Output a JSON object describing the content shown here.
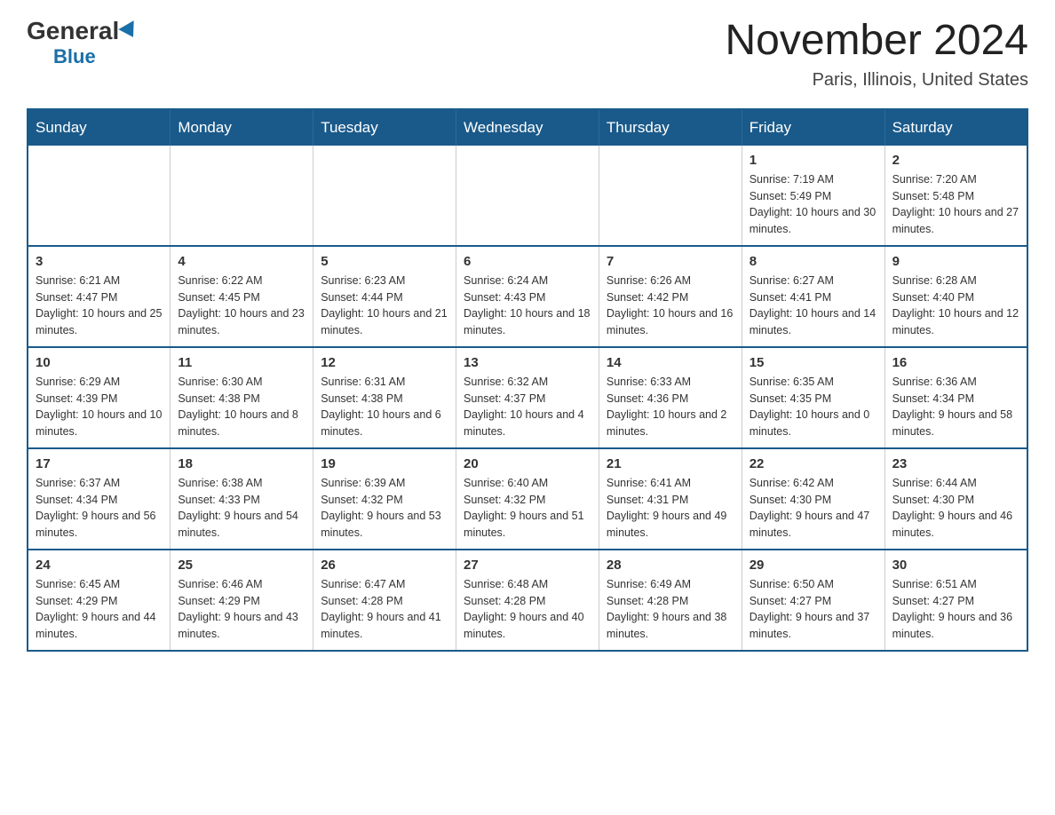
{
  "header": {
    "logo_general": "General",
    "logo_blue": "Blue",
    "month_title": "November 2024",
    "location": "Paris, Illinois, United States"
  },
  "days_of_week": [
    "Sunday",
    "Monday",
    "Tuesday",
    "Wednesday",
    "Thursday",
    "Friday",
    "Saturday"
  ],
  "weeks": [
    [
      {
        "day": "",
        "info": ""
      },
      {
        "day": "",
        "info": ""
      },
      {
        "day": "",
        "info": ""
      },
      {
        "day": "",
        "info": ""
      },
      {
        "day": "",
        "info": ""
      },
      {
        "day": "1",
        "info": "Sunrise: 7:19 AM\nSunset: 5:49 PM\nDaylight: 10 hours and 30 minutes."
      },
      {
        "day": "2",
        "info": "Sunrise: 7:20 AM\nSunset: 5:48 PM\nDaylight: 10 hours and 27 minutes."
      }
    ],
    [
      {
        "day": "3",
        "info": "Sunrise: 6:21 AM\nSunset: 4:47 PM\nDaylight: 10 hours and 25 minutes."
      },
      {
        "day": "4",
        "info": "Sunrise: 6:22 AM\nSunset: 4:45 PM\nDaylight: 10 hours and 23 minutes."
      },
      {
        "day": "5",
        "info": "Sunrise: 6:23 AM\nSunset: 4:44 PM\nDaylight: 10 hours and 21 minutes."
      },
      {
        "day": "6",
        "info": "Sunrise: 6:24 AM\nSunset: 4:43 PM\nDaylight: 10 hours and 18 minutes."
      },
      {
        "day": "7",
        "info": "Sunrise: 6:26 AM\nSunset: 4:42 PM\nDaylight: 10 hours and 16 minutes."
      },
      {
        "day": "8",
        "info": "Sunrise: 6:27 AM\nSunset: 4:41 PM\nDaylight: 10 hours and 14 minutes."
      },
      {
        "day": "9",
        "info": "Sunrise: 6:28 AM\nSunset: 4:40 PM\nDaylight: 10 hours and 12 minutes."
      }
    ],
    [
      {
        "day": "10",
        "info": "Sunrise: 6:29 AM\nSunset: 4:39 PM\nDaylight: 10 hours and 10 minutes."
      },
      {
        "day": "11",
        "info": "Sunrise: 6:30 AM\nSunset: 4:38 PM\nDaylight: 10 hours and 8 minutes."
      },
      {
        "day": "12",
        "info": "Sunrise: 6:31 AM\nSunset: 4:38 PM\nDaylight: 10 hours and 6 minutes."
      },
      {
        "day": "13",
        "info": "Sunrise: 6:32 AM\nSunset: 4:37 PM\nDaylight: 10 hours and 4 minutes."
      },
      {
        "day": "14",
        "info": "Sunrise: 6:33 AM\nSunset: 4:36 PM\nDaylight: 10 hours and 2 minutes."
      },
      {
        "day": "15",
        "info": "Sunrise: 6:35 AM\nSunset: 4:35 PM\nDaylight: 10 hours and 0 minutes."
      },
      {
        "day": "16",
        "info": "Sunrise: 6:36 AM\nSunset: 4:34 PM\nDaylight: 9 hours and 58 minutes."
      }
    ],
    [
      {
        "day": "17",
        "info": "Sunrise: 6:37 AM\nSunset: 4:34 PM\nDaylight: 9 hours and 56 minutes."
      },
      {
        "day": "18",
        "info": "Sunrise: 6:38 AM\nSunset: 4:33 PM\nDaylight: 9 hours and 54 minutes."
      },
      {
        "day": "19",
        "info": "Sunrise: 6:39 AM\nSunset: 4:32 PM\nDaylight: 9 hours and 53 minutes."
      },
      {
        "day": "20",
        "info": "Sunrise: 6:40 AM\nSunset: 4:32 PM\nDaylight: 9 hours and 51 minutes."
      },
      {
        "day": "21",
        "info": "Sunrise: 6:41 AM\nSunset: 4:31 PM\nDaylight: 9 hours and 49 minutes."
      },
      {
        "day": "22",
        "info": "Sunrise: 6:42 AM\nSunset: 4:30 PM\nDaylight: 9 hours and 47 minutes."
      },
      {
        "day": "23",
        "info": "Sunrise: 6:44 AM\nSunset: 4:30 PM\nDaylight: 9 hours and 46 minutes."
      }
    ],
    [
      {
        "day": "24",
        "info": "Sunrise: 6:45 AM\nSunset: 4:29 PM\nDaylight: 9 hours and 44 minutes."
      },
      {
        "day": "25",
        "info": "Sunrise: 6:46 AM\nSunset: 4:29 PM\nDaylight: 9 hours and 43 minutes."
      },
      {
        "day": "26",
        "info": "Sunrise: 6:47 AM\nSunset: 4:28 PM\nDaylight: 9 hours and 41 minutes."
      },
      {
        "day": "27",
        "info": "Sunrise: 6:48 AM\nSunset: 4:28 PM\nDaylight: 9 hours and 40 minutes."
      },
      {
        "day": "28",
        "info": "Sunrise: 6:49 AM\nSunset: 4:28 PM\nDaylight: 9 hours and 38 minutes."
      },
      {
        "day": "29",
        "info": "Sunrise: 6:50 AM\nSunset: 4:27 PM\nDaylight: 9 hours and 37 minutes."
      },
      {
        "day": "30",
        "info": "Sunrise: 6:51 AM\nSunset: 4:27 PM\nDaylight: 9 hours and 36 minutes."
      }
    ]
  ]
}
